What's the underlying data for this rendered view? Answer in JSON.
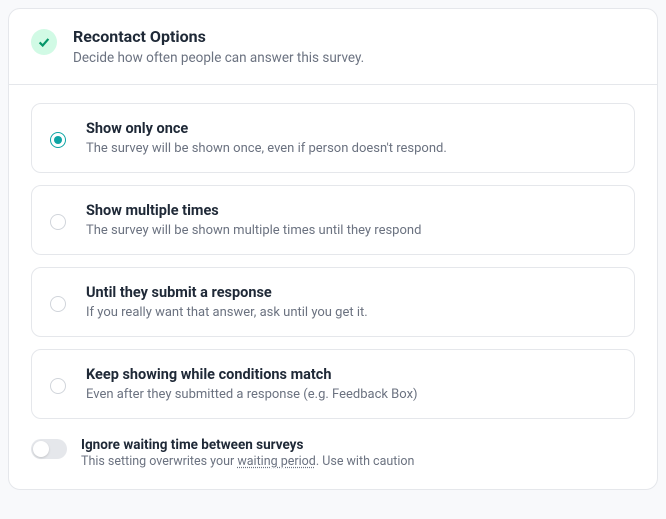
{
  "header": {
    "title": "Recontact Options",
    "subtitle": "Decide how often people can answer this survey."
  },
  "options": [
    {
      "title": "Show only once",
      "description": "The survey will be shown once, even if person doesn't respond.",
      "selected": true
    },
    {
      "title": "Show multiple times",
      "description": "The survey will be shown multiple times until they respond",
      "selected": false
    },
    {
      "title": "Until they submit a response",
      "description": "If you really want that answer, ask until you get it.",
      "selected": false
    },
    {
      "title": "Keep showing while conditions match",
      "description": "Even after they submitted a response (e.g. Feedback Box)",
      "selected": false
    }
  ],
  "footer": {
    "title": "Ignore waiting time between surveys",
    "prefix": "This setting overwrites your ",
    "link": "waiting period",
    "suffix": ". Use with caution"
  }
}
